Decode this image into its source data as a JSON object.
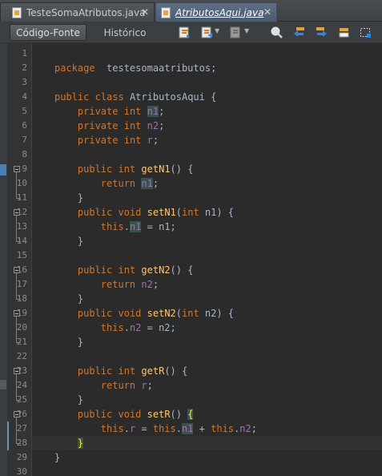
{
  "tabs": [
    {
      "label": "TesteSomaAtributos.java",
      "close": "✕",
      "active": false
    },
    {
      "label": "AtributosAqui.java",
      "close": "✕",
      "active": true
    }
  ],
  "toolbar": {
    "source_label": "Código-Fonte",
    "history_label": "Histórico",
    "icons": [
      "last-edit-icon",
      "back-icon",
      "forward-icon",
      "search-icon",
      "find-previous-icon",
      "find-next-icon",
      "toggle-highlight-icon",
      "rectangular-selection-icon"
    ]
  },
  "colors": {
    "keyword": "#cc7832",
    "method": "#ffc66d",
    "field": "#9876aa",
    "text": "#a9b7c6",
    "background": "#2b2b2b",
    "active_tab": "#4b5a70"
  },
  "code": {
    "current_line": 28,
    "lines": [
      {
        "n": "1",
        "t": []
      },
      {
        "n": "2",
        "t": [
          [
            "kw",
            "package"
          ],
          [
            "",
            "  testesomaatributos;"
          ]
        ]
      },
      {
        "n": "3",
        "t": []
      },
      {
        "n": "4",
        "t": [
          [
            "kw",
            "public"
          ],
          [
            "",
            " "
          ],
          [
            "kw",
            "class"
          ],
          [
            "",
            " AtributosAqui {"
          ]
        ]
      },
      {
        "n": "5",
        "t": [
          [
            "",
            "    "
          ],
          [
            "kw",
            "private"
          ],
          [
            "",
            " "
          ],
          [
            "kw",
            "int"
          ],
          [
            "",
            " "
          ],
          [
            "fld hl",
            "n1"
          ],
          [
            "",
            ";"
          ]
        ]
      },
      {
        "n": "6",
        "t": [
          [
            "",
            "    "
          ],
          [
            "kw",
            "private"
          ],
          [
            "",
            " "
          ],
          [
            "kw",
            "int"
          ],
          [
            "",
            " "
          ],
          [
            "fld",
            "n2"
          ],
          [
            "",
            ";"
          ]
        ]
      },
      {
        "n": "7",
        "t": [
          [
            "",
            "    "
          ],
          [
            "kw",
            "private"
          ],
          [
            "",
            " "
          ],
          [
            "kw",
            "int"
          ],
          [
            "",
            " "
          ],
          [
            "fld",
            "r"
          ],
          [
            "",
            ";"
          ]
        ]
      },
      {
        "n": "8",
        "t": []
      },
      {
        "n": "9",
        "t": [
          [
            "",
            "    "
          ],
          [
            "kw",
            "public"
          ],
          [
            "",
            " "
          ],
          [
            "kw",
            "int"
          ],
          [
            "",
            " "
          ],
          [
            "fn",
            "getN1"
          ],
          [
            "",
            "() {"
          ]
        ]
      },
      {
        "n": "10",
        "t": [
          [
            "",
            "        "
          ],
          [
            "kw",
            "return"
          ],
          [
            "",
            " "
          ],
          [
            "fld hl",
            "n1"
          ],
          [
            "",
            ";"
          ]
        ]
      },
      {
        "n": "11",
        "t": [
          [
            "",
            "    }"
          ]
        ]
      },
      {
        "n": "12",
        "t": [
          [
            "",
            "    "
          ],
          [
            "kw",
            "public"
          ],
          [
            "",
            " "
          ],
          [
            "kw",
            "void"
          ],
          [
            "",
            " "
          ],
          [
            "fn",
            "setN1"
          ],
          [
            "",
            "("
          ],
          [
            "kw",
            "int"
          ],
          [
            "",
            " n1) {"
          ]
        ]
      },
      {
        "n": "13",
        "t": [
          [
            "",
            "        "
          ],
          [
            "kw",
            "this"
          ],
          [
            "",
            "."
          ],
          [
            "fld hl",
            "n1"
          ],
          [
            "",
            " = n1;"
          ]
        ]
      },
      {
        "n": "14",
        "t": [
          [
            "",
            "    }"
          ]
        ]
      },
      {
        "n": "15",
        "t": []
      },
      {
        "n": "16",
        "t": [
          [
            "",
            "    "
          ],
          [
            "kw",
            "public"
          ],
          [
            "",
            " "
          ],
          [
            "kw",
            "int"
          ],
          [
            "",
            " "
          ],
          [
            "fn",
            "getN2"
          ],
          [
            "",
            "() {"
          ]
        ]
      },
      {
        "n": "17",
        "t": [
          [
            "",
            "        "
          ],
          [
            "kw",
            "return"
          ],
          [
            "",
            " "
          ],
          [
            "fld",
            "n2"
          ],
          [
            "",
            ";"
          ]
        ]
      },
      {
        "n": "18",
        "t": [
          [
            "",
            "    }"
          ]
        ]
      },
      {
        "n": "19",
        "t": [
          [
            "",
            "    "
          ],
          [
            "kw",
            "public"
          ],
          [
            "",
            " "
          ],
          [
            "kw",
            "void"
          ],
          [
            "",
            " "
          ],
          [
            "fn",
            "setN2"
          ],
          [
            "",
            "("
          ],
          [
            "kw",
            "int"
          ],
          [
            "",
            " n2) {"
          ]
        ]
      },
      {
        "n": "20",
        "t": [
          [
            "",
            "        "
          ],
          [
            "kw",
            "this"
          ],
          [
            "",
            "."
          ],
          [
            "fld",
            "n2"
          ],
          [
            "",
            " = n2;"
          ]
        ]
      },
      {
        "n": "21",
        "t": [
          [
            "",
            "    }"
          ]
        ]
      },
      {
        "n": "22",
        "t": []
      },
      {
        "n": "23",
        "t": [
          [
            "",
            "    "
          ],
          [
            "kw",
            "public"
          ],
          [
            "",
            " "
          ],
          [
            "kw",
            "int"
          ],
          [
            "",
            " "
          ],
          [
            "fn",
            "getR"
          ],
          [
            "",
            "() {"
          ]
        ]
      },
      {
        "n": "24",
        "t": [
          [
            "",
            "        "
          ],
          [
            "kw",
            "return"
          ],
          [
            "",
            " "
          ],
          [
            "fld",
            "r"
          ],
          [
            "",
            ";"
          ]
        ]
      },
      {
        "n": "25",
        "t": [
          [
            "",
            "    }"
          ]
        ]
      },
      {
        "n": "26",
        "t": [
          [
            "",
            "    "
          ],
          [
            "kw",
            "public"
          ],
          [
            "",
            " "
          ],
          [
            "kw",
            "void"
          ],
          [
            "",
            " "
          ],
          [
            "fn",
            "setR"
          ],
          [
            "",
            "() "
          ],
          [
            "brace-hl",
            "{"
          ]
        ]
      },
      {
        "n": "27",
        "t": [
          [
            "",
            "        "
          ],
          [
            "kw",
            "this"
          ],
          [
            "",
            "."
          ],
          [
            "fld",
            "r"
          ],
          [
            "",
            " = "
          ],
          [
            "kw",
            "this"
          ],
          [
            "",
            "."
          ],
          [
            "fld hl",
            "n1"
          ],
          [
            "",
            " + "
          ],
          [
            "kw",
            "this"
          ],
          [
            "",
            "."
          ],
          [
            "fld",
            "n2"
          ],
          [
            "",
            ";"
          ]
        ]
      },
      {
        "n": "28",
        "t": [
          [
            "",
            "    "
          ],
          [
            "brace-hl",
            "}"
          ]
        ]
      },
      {
        "n": "29",
        "t": [
          [
            "",
            "}"
          ]
        ]
      },
      {
        "n": "30",
        "t": []
      }
    ]
  }
}
